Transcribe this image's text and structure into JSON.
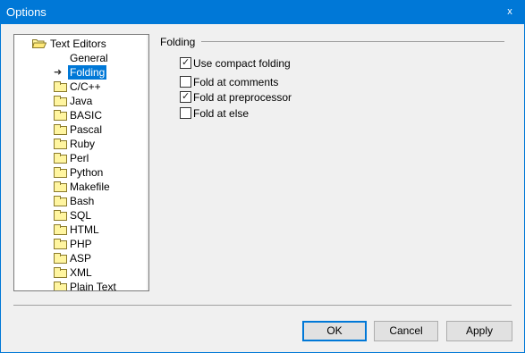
{
  "window": {
    "title": "Options",
    "close_label": "x"
  },
  "tree": {
    "parent": "Text Editors",
    "children": [
      {
        "label": "General",
        "icon": "none",
        "selected": false
      },
      {
        "label": "Folding",
        "icon": "arrow-icon",
        "selected": true
      },
      {
        "label": "C/C++",
        "icon": "folder-icon"
      },
      {
        "label": "Java",
        "icon": "folder-icon"
      },
      {
        "label": "BASIC",
        "icon": "folder-icon"
      },
      {
        "label": "Pascal",
        "icon": "folder-icon"
      },
      {
        "label": "Ruby",
        "icon": "folder-icon"
      },
      {
        "label": "Perl",
        "icon": "folder-icon"
      },
      {
        "label": "Python",
        "icon": "folder-icon"
      },
      {
        "label": "Makefile",
        "icon": "folder-icon"
      },
      {
        "label": "Bash",
        "icon": "folder-icon"
      },
      {
        "label": "SQL",
        "icon": "folder-icon"
      },
      {
        "label": "HTML",
        "icon": "folder-icon"
      },
      {
        "label": "PHP",
        "icon": "folder-icon"
      },
      {
        "label": "ASP",
        "icon": "folder-icon"
      },
      {
        "label": "XML",
        "icon": "folder-icon"
      },
      {
        "label": "Plain Text",
        "icon": "folder-icon"
      }
    ]
  },
  "folding": {
    "group_title": "Folding",
    "options": [
      {
        "label": "Use compact folding",
        "checked": true
      },
      {
        "label": "Fold at comments",
        "checked": false
      },
      {
        "label": "Fold at preprocessor",
        "checked": true
      },
      {
        "label": "Fold at else",
        "checked": false
      }
    ]
  },
  "buttons": {
    "ok": "OK",
    "cancel": "Cancel",
    "apply": "Apply"
  },
  "colors": {
    "accent": "#0078d7",
    "folder": "#fff5a0"
  }
}
